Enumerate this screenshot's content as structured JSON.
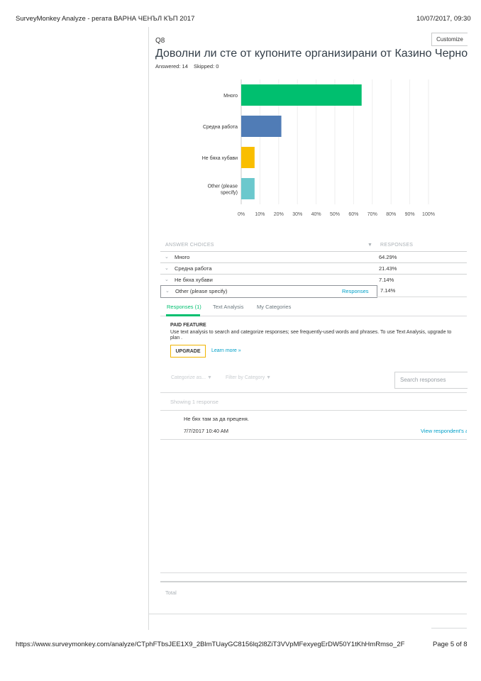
{
  "header": {
    "title": "SurveyMonkey Analyze - регата ВАРНА ЧЕНЪЛ КЪП 2017",
    "datetime": "10/07/2017, 09:30"
  },
  "question": {
    "number": "Q8",
    "customize_label": "Customize",
    "title": "Доволни ли сте от купоните организирани от Казино Черно море",
    "answered": "Answered: 14",
    "skipped": "Skipped: 0"
  },
  "chart_data": {
    "type": "bar",
    "orientation": "horizontal",
    "categories": [
      "Много",
      "Средна работа",
      "Не бяха хубави",
      "Other (please specify)"
    ],
    "category_lines": [
      [
        "Много"
      ],
      [
        "Средна работа"
      ],
      [
        "Не бяха хубави"
      ],
      [
        "Other (please",
        "specify)"
      ]
    ],
    "values": [
      64.29,
      21.43,
      7.14,
      7.14
    ],
    "colors": [
      "#00bf6f",
      "#507cb6",
      "#f9be00",
      "#6bc8cd"
    ],
    "xlim": [
      0,
      100
    ],
    "xticks": [
      "0%",
      "10%",
      "20%",
      "30%",
      "40%",
      "50%",
      "60%",
      "70%",
      "80%",
      "90%",
      "100%"
    ],
    "grid": true
  },
  "table": {
    "col_answer": "ANSWER CHOICES",
    "col_responses": "RESPONSES",
    "rows": [
      {
        "label": "Много",
        "pct": "64.29%"
      },
      {
        "label": "Средна работа",
        "pct": "21.43%"
      },
      {
        "label": "Не бяха хубави",
        "pct": "7.14%"
      },
      {
        "label": "Other (please specify)",
        "pct": "7.14%",
        "link": "Responses"
      }
    ]
  },
  "tabs": {
    "responses": "Responses (1)",
    "text_analysis": "Text Analysis",
    "my_categories": "My Categories"
  },
  "paid": {
    "title": "PAID FEATURE",
    "desc_line1": "Use text analysis to search and categorize responses; see frequently-used words and phrases. To use Text Analysis, upgrade to",
    "desc_line2": "plan .",
    "upgrade_label": "UPGRADE",
    "learn_more": "Learn more »"
  },
  "filters": {
    "categorize": "Categorize as... ▼",
    "filter_by": "Filter by Category ▼",
    "search_placeholder": "Search responses"
  },
  "responses": {
    "showing": "Showing 1 response",
    "items": [
      {
        "text": "Не бях там за да преценя.",
        "date": "7/7/2017 10:40 AM",
        "link": "View respondent's answers"
      }
    ]
  },
  "total_label": "Total",
  "footer": {
    "url": "https://www.surveymonkey.com/analyze/CTphFTbsJEE1X9_2BlmTUayGC8156lq2l8ZiT3VVpMFexyegErDW50Y1tKhHmRmso_2F",
    "page": "Page 5 of 8"
  }
}
